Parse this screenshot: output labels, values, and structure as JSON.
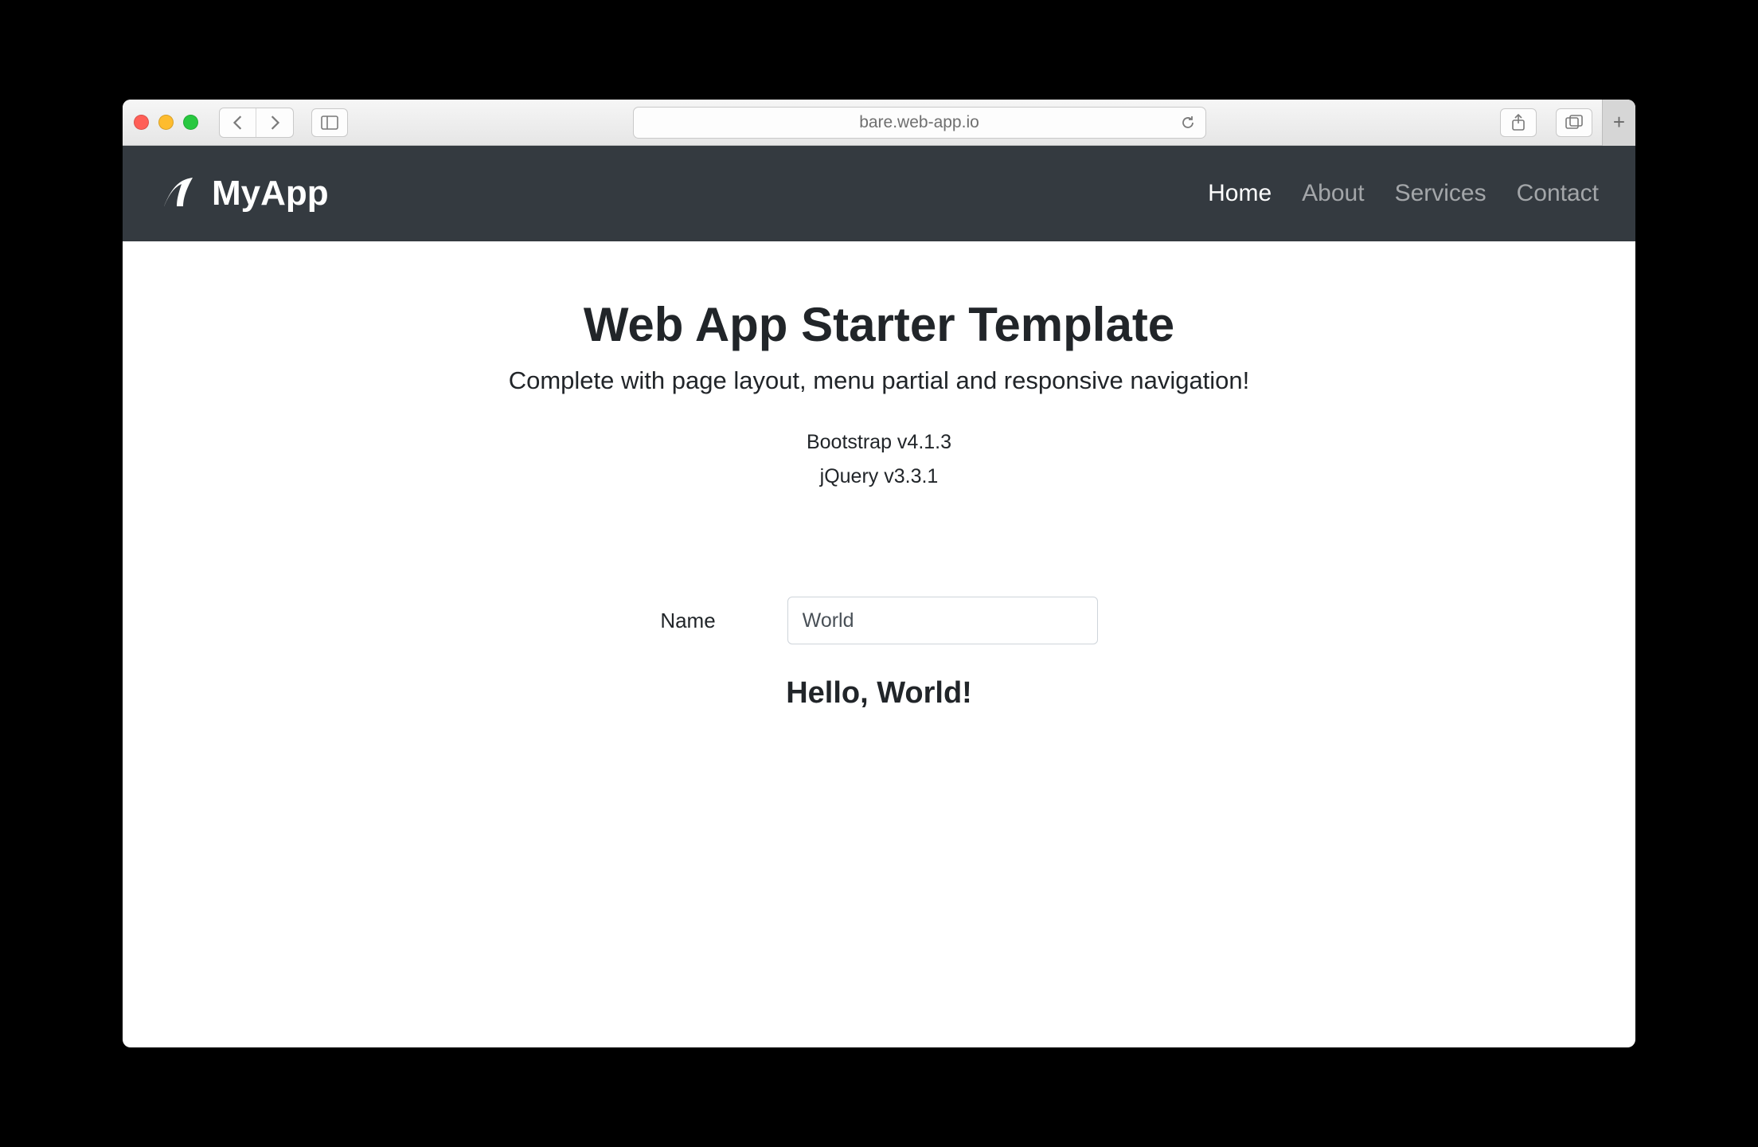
{
  "browser": {
    "address": "bare.web-app.io"
  },
  "nav": {
    "brand": "MyApp",
    "links": [
      {
        "label": "Home",
        "active": true
      },
      {
        "label": "About",
        "active": false
      },
      {
        "label": "Services",
        "active": false
      },
      {
        "label": "Contact",
        "active": false
      }
    ]
  },
  "hero": {
    "title": "Web App Starter Template",
    "subtitle": "Complete with page layout, menu partial and responsive navigation!",
    "version_bootstrap": "Bootstrap v4.1.3",
    "version_jquery": "jQuery v3.3.1"
  },
  "form": {
    "label": "Name",
    "value": "World"
  },
  "greeting": "Hello, World!"
}
